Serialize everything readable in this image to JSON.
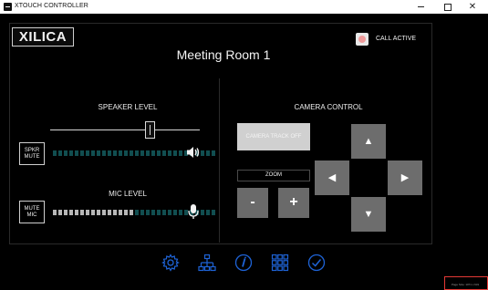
{
  "window": {
    "title": "XTOUCH CONTROLLER",
    "close_glyph": "✕"
  },
  "header": {
    "logo_text": "XILICA",
    "room_name": "Meeting Room 1",
    "call_status": "CALL ACTIVE"
  },
  "speaker": {
    "title": "SPEAKER LEVEL",
    "mute_label_line1": "SPKR",
    "mute_label_line2": "MUTE",
    "level_percent": 67,
    "meter_segments": 30,
    "meter_lit": 0,
    "icon": "speaker-icon"
  },
  "mic": {
    "title": "MIC LEVEL",
    "mute_label_line1": "MUTE",
    "mute_label_line2": "MIC",
    "meter_segments": 30,
    "meter_lit": 15,
    "icon": "microphone-icon"
  },
  "camera": {
    "title": "CAMERA CONTROL",
    "track_label": "CAMERA TRACK OFF",
    "zoom_label": "ZOOM",
    "zoom_out": "-",
    "zoom_in": "+",
    "up": "▲",
    "left": "◀",
    "right": "▶",
    "down": "▼"
  },
  "nav": {
    "items": [
      "settings-icon",
      "network-icon",
      "info-icon",
      "grid-icon",
      "check-icon"
    ],
    "accent": "#1e63d6"
  },
  "colors": {
    "meter_off": "#114e50",
    "meter_on": "#b7b7b7",
    "button_gray": "#6d6d6d",
    "call_indicator": "#ef9a9a"
  },
  "footer": {
    "page_size_text": "Page Size: 1071 x 631"
  }
}
